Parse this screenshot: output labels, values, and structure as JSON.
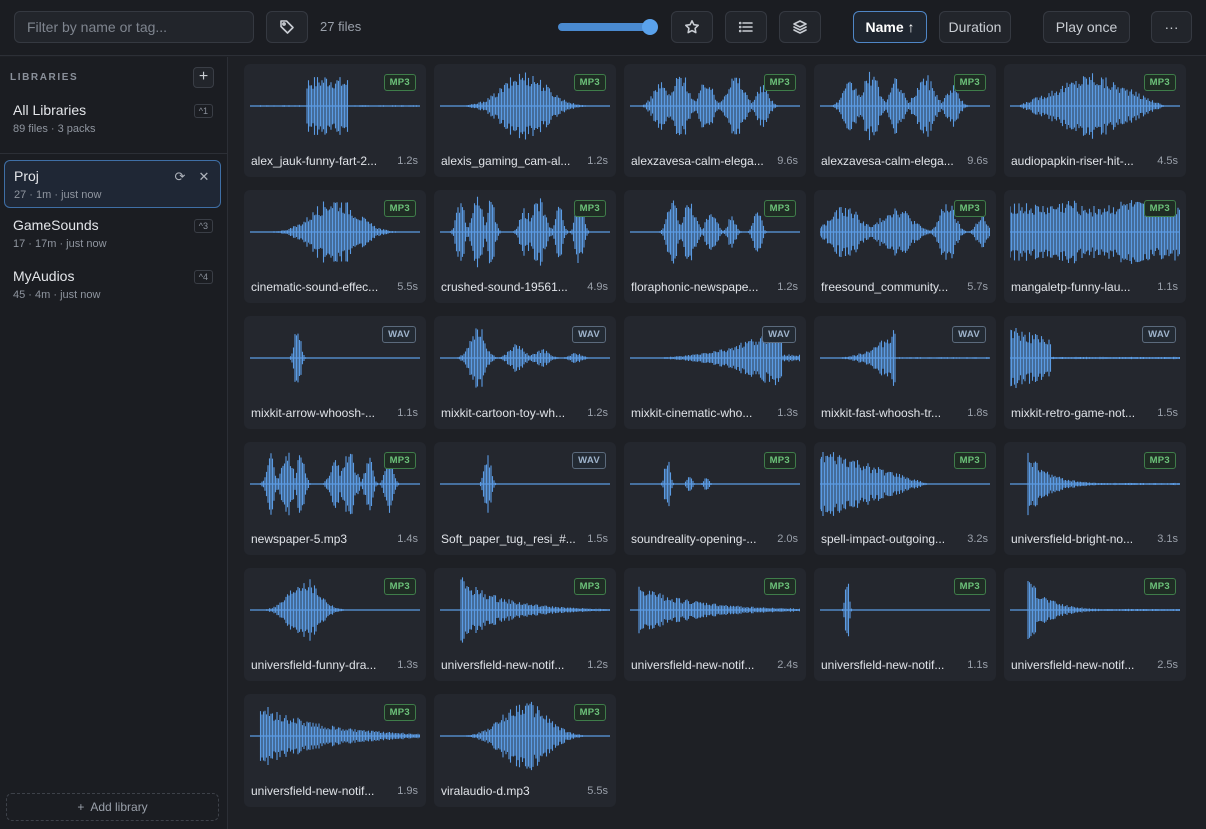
{
  "toolbar": {
    "filter_placeholder": "Filter by name or tag...",
    "file_count": "27 files",
    "sort_name_label": "Name ↑",
    "sort_duration_label": "Duration",
    "play_mode_label": "Play once",
    "more_label": "···",
    "accent_color": "#4f86c6",
    "zoom_level": 1.0
  },
  "sidebar": {
    "heading": "LIBRARIES",
    "add_label": "+",
    "add_library_label": "Add library",
    "items": [
      {
        "name": "All Libraries",
        "meta": "89 files · 3 packs",
        "key": "^1"
      },
      {
        "name": "Proj",
        "meta": "27 · 1m · just now",
        "key": ""
      },
      {
        "name": "GameSounds",
        "meta": "17 · 17m · just now",
        "key": "^3"
      },
      {
        "name": "MyAudios",
        "meta": "45 · 4m · just now",
        "key": "^4"
      }
    ]
  },
  "wave_color": "#5b9be3",
  "files": [
    {
      "name": "alex_jauk-funny-fart-2...",
      "dur": "1.2s",
      "fmt": "MP3",
      "shape": "burst-c"
    },
    {
      "name": "alexis_gaming_cam-al...",
      "dur": "1.2s",
      "fmt": "MP3",
      "shape": "center"
    },
    {
      "name": "alexzavesa-calm-elega...",
      "dur": "9.6s",
      "fmt": "MP3",
      "shape": "multi"
    },
    {
      "name": "alexzavesa-calm-elega...",
      "dur": "9.6s",
      "fmt": "MP3",
      "shape": "multi"
    },
    {
      "name": "audiopapkin-riser-hit-...",
      "dur": "4.5s",
      "fmt": "MP3",
      "shape": "diamond"
    },
    {
      "name": "cinematic-sound-effec...",
      "dur": "5.5s",
      "fmt": "MP3",
      "shape": "center"
    },
    {
      "name": "crushed-sound-19561...",
      "dur": "4.9s",
      "fmt": "MP3",
      "shape": "spiky"
    },
    {
      "name": "floraphonic-newspape...",
      "dur": "1.2s",
      "fmt": "MP3",
      "shape": "spiky2"
    },
    {
      "name": "freesound_community...",
      "dur": "5.7s",
      "fmt": "MP3",
      "shape": "dense"
    },
    {
      "name": "mangaletp-funny-lau...",
      "dur": "1.1s",
      "fmt": "MP3",
      "shape": "full"
    },
    {
      "name": "mixkit-arrow-whoosh-...",
      "dur": "1.1s",
      "fmt": "WAV",
      "shape": "spike-early"
    },
    {
      "name": "mixkit-cartoon-toy-wh...",
      "dur": "1.2s",
      "fmt": "WAV",
      "shape": "toy"
    },
    {
      "name": "mixkit-cinematic-who...",
      "dur": "1.3s",
      "fmt": "WAV",
      "shape": "riser"
    },
    {
      "name": "mixkit-fast-whoosh-tr...",
      "dur": "1.8s",
      "fmt": "WAV",
      "shape": "whoosh"
    },
    {
      "name": "mixkit-retro-game-not...",
      "dur": "1.5s",
      "fmt": "WAV",
      "shape": "start-decay"
    },
    {
      "name": "newspaper-5.mp3",
      "dur": "1.4s",
      "fmt": "MP3",
      "shape": "spiky"
    },
    {
      "name": "Soft_paper_tug,_resi_#...",
      "dur": "1.5s",
      "fmt": "WAV",
      "shape": "spike-early"
    },
    {
      "name": "soundreality-opening-...",
      "dur": "2.0s",
      "fmt": "MP3",
      "shape": "spike-small"
    },
    {
      "name": "spell-impact-outgoing...",
      "dur": "3.2s",
      "fmt": "MP3",
      "shape": "impact"
    },
    {
      "name": "universfield-bright-no...",
      "dur": "3.1s",
      "fmt": "MP3",
      "shape": "pluck"
    },
    {
      "name": "universfield-funny-dra...",
      "dur": "1.3s",
      "fmt": "MP3",
      "shape": "blob"
    },
    {
      "name": "universfield-new-notif...",
      "dur": "1.2s",
      "fmt": "MP3",
      "shape": "notif"
    },
    {
      "name": "universfield-new-notif...",
      "dur": "2.4s",
      "fmt": "MP3",
      "shape": "notif2"
    },
    {
      "name": "universfield-new-notif...",
      "dur": "1.1s",
      "fmt": "MP3",
      "shape": "tick"
    },
    {
      "name": "universfield-new-notif...",
      "dur": "2.5s",
      "fmt": "MP3",
      "shape": "pluck"
    },
    {
      "name": "universfield-new-notif...",
      "dur": "1.9s",
      "fmt": "MP3",
      "shape": "horn"
    },
    {
      "name": "viralaudio-d.mp3",
      "dur": "5.5s",
      "fmt": "MP3",
      "shape": "center"
    }
  ]
}
